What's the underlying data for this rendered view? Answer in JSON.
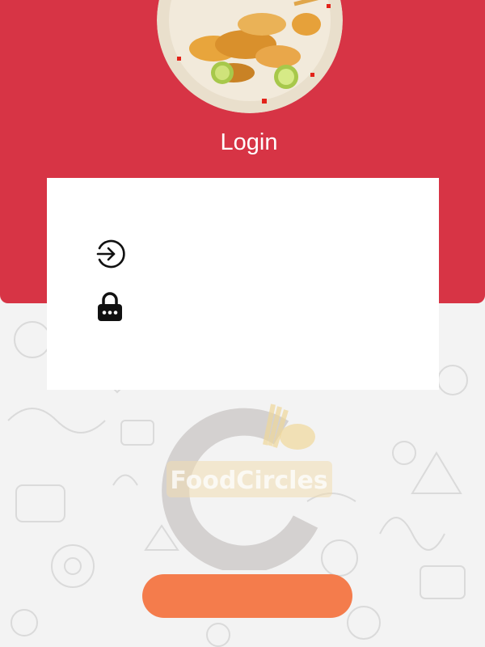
{
  "header": {
    "title": "Login",
    "background_color": "#d73445",
    "image": "fried-seafood-plate"
  },
  "form": {
    "username_icon": "login-arrow-icon",
    "password_icon": "lock-icon",
    "username_value": "",
    "password_value": ""
  },
  "logo": {
    "text": "FoodCircles"
  },
  "login_button": {
    "label": "",
    "color": "#f47c4c"
  }
}
